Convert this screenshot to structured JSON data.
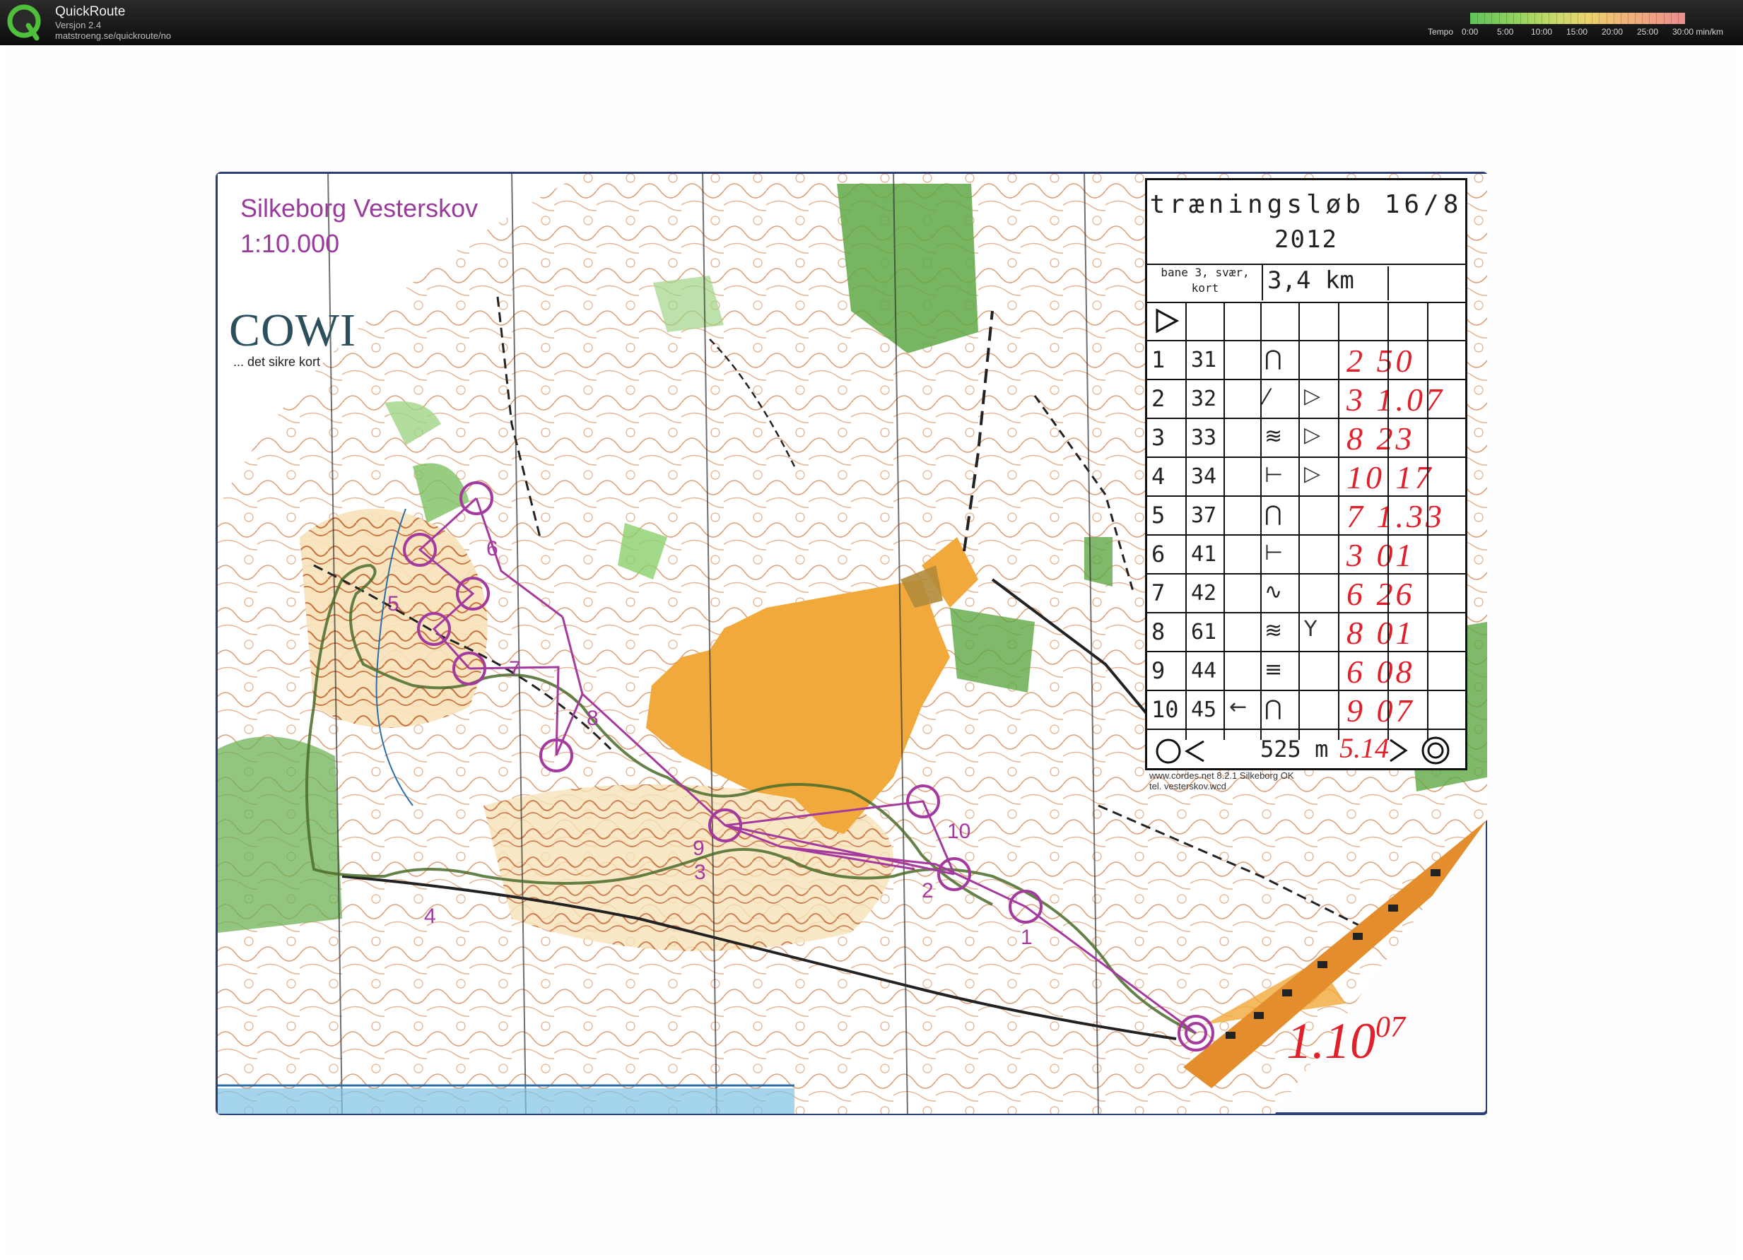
{
  "app": {
    "name": "QuickRoute",
    "version": "Versjon 2.4",
    "url": "matstroeng.se/quickroute/no"
  },
  "tempo": {
    "label": "Tempo",
    "ticks": [
      "0:00",
      "5:00",
      "10:00",
      "15:00",
      "20:00",
      "25:00",
      "30:00 min/km"
    ],
    "colors": [
      "#5fc35a",
      "#c9dc6a",
      "#ecd36a",
      "#ee8c8c"
    ]
  },
  "map": {
    "area": "Silkeborg Vesterskov",
    "scale": "1:10.000",
    "publisher": "COWI",
    "publisher_tagline": "... det sikre kort",
    "colors": {
      "course": "#a4399e",
      "route": "#4a6b2a",
      "open_land": "#f1a93b",
      "forest_green": "#5fa845",
      "contour": "#c96a2a"
    }
  },
  "card": {
    "title": "træningsløb 16/8",
    "year": "2012",
    "course": "bane 3, svær, kort",
    "length": "3,4 km",
    "controls": [
      {
        "num": "1",
        "code": "31",
        "symbol": "⋂",
        "extra": "",
        "split": "2 50"
      },
      {
        "num": "2",
        "code": "32",
        "symbol": "⁄",
        "extra": "▷",
        "split": "3 1.07"
      },
      {
        "num": "3",
        "code": "33",
        "symbol": "≋",
        "extra": "▷",
        "split": "8 23"
      },
      {
        "num": "4",
        "code": "34",
        "symbol": "⊢",
        "extra": "▷",
        "split": "10 17"
      },
      {
        "num": "5",
        "code": "37",
        "symbol": "⋂",
        "extra": "",
        "split": "7 1.33"
      },
      {
        "num": "6",
        "code": "41",
        "symbol": "⊢",
        "extra": "",
        "split": "3 01"
      },
      {
        "num": "7",
        "code": "42",
        "symbol": "∿",
        "extra": "",
        "split": "6 26"
      },
      {
        "num": "8",
        "code": "61",
        "symbol": "≋",
        "extra": "Y",
        "split": "8 01"
      },
      {
        "num": "9",
        "code": "44",
        "symbol": "≡",
        "extra": "",
        "split": "6 08"
      },
      {
        "num": "10",
        "code": "45",
        "symbol": "⋂",
        "extra": "←",
        "split": "9 07"
      }
    ],
    "finish": {
      "distance": "525 m",
      "split": "5.14"
    },
    "credits": [
      "www.cordes.net 8.2.1 Silkeborg OK",
      "tel. vesterskov.wcd"
    ]
  },
  "handwritten_total": "1.10",
  "handwritten_total_seconds": "07",
  "control_labels": [
    "1",
    "2",
    "3",
    "4",
    "5",
    "6",
    "7",
    "8",
    "9",
    "10"
  ]
}
